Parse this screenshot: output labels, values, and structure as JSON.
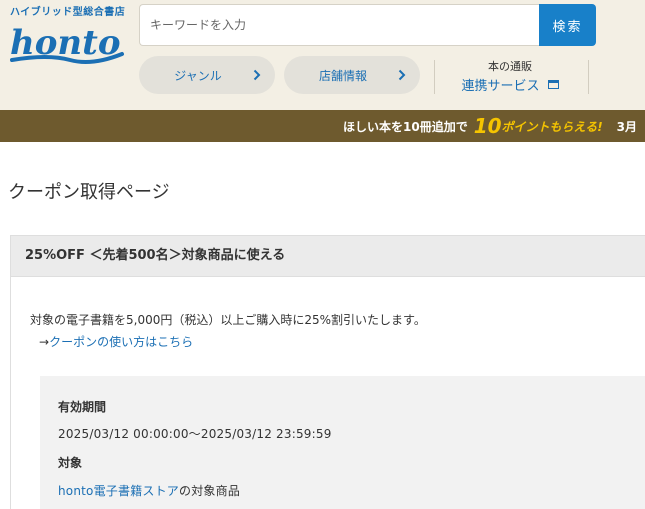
{
  "header": {
    "tagline": "ハイブリッド型総合書店",
    "logo_text": "honto",
    "search": {
      "placeholder": "キーワードを入力",
      "button_label": "検索"
    },
    "nav": {
      "genre_label": "ジャンル",
      "store_label": "店舗情報"
    },
    "tsuhan": {
      "small_label": "本の通販",
      "main_label": "連携サービス"
    }
  },
  "banner": {
    "text_prefix": "ほしい本を10冊追加で",
    "highlight_number": "10",
    "highlight_text": "ポイントもらえる!",
    "trailing_text": "3月"
  },
  "page": {
    "title": "クーポン取得ページ"
  },
  "coupon": {
    "title": "25%OFF ＜先着500名＞対象商品に使える",
    "description": "対象の電子書籍を5,000円（税込）以上ご購入時に25%割引いたします。",
    "link_arrow": "→",
    "link_label": "クーポンの使い方はこちら",
    "period_label": "有効期間",
    "period_value": "2025/03/12 00:00:00～2025/03/12 23:59:59",
    "target_label": "対象",
    "target_link": "honto電子書籍ストア",
    "target_suffix": "の対象商品"
  },
  "colors": {
    "brand_blue": "#1b6fb4",
    "search_button": "#1880c9",
    "header_bg": "#f3efe4",
    "banner_bg": "#6e5a2e",
    "banner_accent": "#f5c400"
  }
}
